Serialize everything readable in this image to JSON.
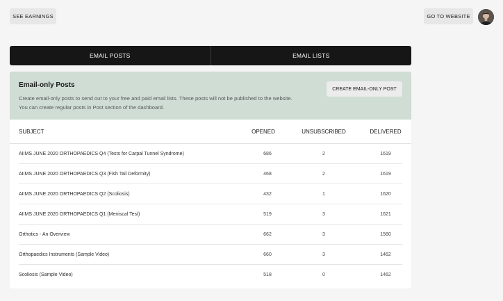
{
  "header": {
    "see_earnings": "SEE EARNINGS",
    "go_to_website": "GO TO WEBSITE"
  },
  "tabs": [
    {
      "label": "EMAIL POSTS"
    },
    {
      "label": "EMAIL LISTS"
    }
  ],
  "card": {
    "title": "Email-only Posts",
    "description": "Create email-only posts to send out to your free and paid email lists. These posts will not be published to the website. You can create regular posts in Post section of the dashboard.",
    "create_button": "CREATE EMAIL-ONLY POST"
  },
  "table": {
    "columns": {
      "subject": "SUBJECT",
      "opened": "OPENED",
      "unsubscribed": "UNSUBSCRIBED",
      "delivered": "DELIVERED"
    },
    "rows": [
      {
        "subject": "AIIMS JUNE 2020 ORTHOPAEDICS Q4 (Tests for Carpal Tunnel Syndrome)",
        "opened": "686",
        "unsubscribed": "2",
        "delivered": "1619"
      },
      {
        "subject": "AIIMS JUNE 2020 ORTHOPAEDICS Q3 (Fish Tail Deformity)",
        "opened": "468",
        "unsubscribed": "2",
        "delivered": "1619"
      },
      {
        "subject": "AIIMS JUNE 2020 ORTHOPAEDICS Q2 (Scoliosis)",
        "opened": "432",
        "unsubscribed": "1",
        "delivered": "1620"
      },
      {
        "subject": "AIIMS JUNE 2020 ORTHOPAEDICS Q1 (Meniscal Test)",
        "opened": "519",
        "unsubscribed": "3",
        "delivered": "1621"
      },
      {
        "subject": "Orthotics - An Overview",
        "opened": "662",
        "unsubscribed": "3",
        "delivered": "1560"
      },
      {
        "subject": "Orthopaedics Instruments (Sample Video)",
        "opened": "660",
        "unsubscribed": "3",
        "delivered": "1462"
      },
      {
        "subject": "Scoliosis (Sample Video)",
        "opened": "518",
        "unsubscribed": "0",
        "delivered": "1462"
      }
    ]
  }
}
